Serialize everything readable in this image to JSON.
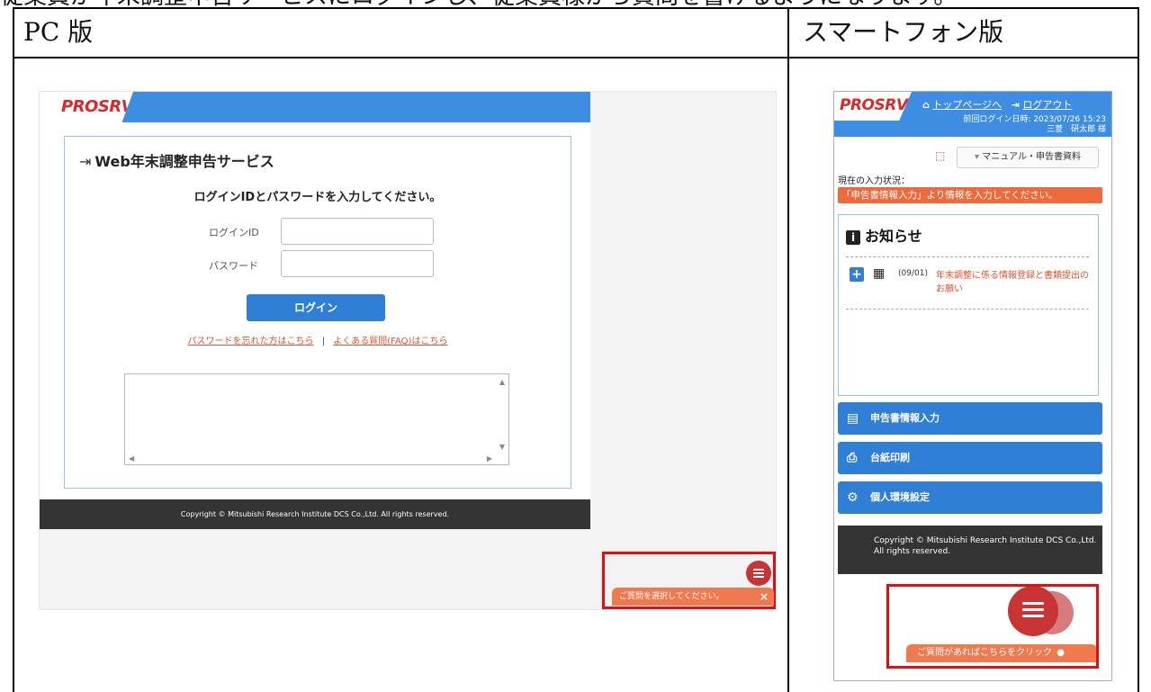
{
  "header_cut_text": "従業員が年末調整申告サービスにログインし、従業員様から質問を書けるようになります。",
  "columns": {
    "pc": "PC 版",
    "smartphone": "スマートフォン版"
  },
  "pc": {
    "logo": "PROSRV",
    "title": "Web年末調整申告サービス",
    "instruction": "ログインIDとパスワードを入力してください。",
    "login_id_label": "ログインID",
    "password_label": "パスワード",
    "login_button": "ログイン",
    "forgot_link": "パスワードを忘れた方はこちら",
    "separator": "|",
    "faq_link": "よくある質問(FAQ)はこちら",
    "footer": "Copyright © Mitsubishi Research Institute DCS Co.,Ltd. All rights reserved.",
    "chat_bar": "ご質問を選択してください。",
    "chat_close": "×",
    "colors": {
      "brand_blue": "#3d8de2",
      "accent_red": "#d72b2b",
      "chat_orange": "#f07a4f",
      "highlight_red": "#e01010"
    }
  },
  "smartphone": {
    "logo": "PROSRV",
    "top_page_link": "トップページへ",
    "logout_link": "ログアウト",
    "last_login": "前回ログイン日時: 2023/07/26 15:23",
    "user_name": "三菱　研太郎 様",
    "manual_button": "マニュアル・申告書資料",
    "status_label": "現在の入力状況：",
    "status_message": "「申告書情報入力」より情報を入力してください。",
    "news": {
      "title": "お知らせ",
      "date": "(09/01)",
      "item": "年末調整に係る情報登録と書類提出のお願い"
    },
    "menu": [
      {
        "label": "申告書情報入力",
        "icon": "form-icon"
      },
      {
        "label": "台紙印刷",
        "icon": "printer-icon"
      },
      {
        "label": "個人環境設定",
        "icon": "gear-icon"
      }
    ],
    "footer": "Copyright © Mitsubishi Research Institute DCS Co.,Ltd. All rights reserved.",
    "chat_bar": "ご質問があればこちらをクリック"
  }
}
